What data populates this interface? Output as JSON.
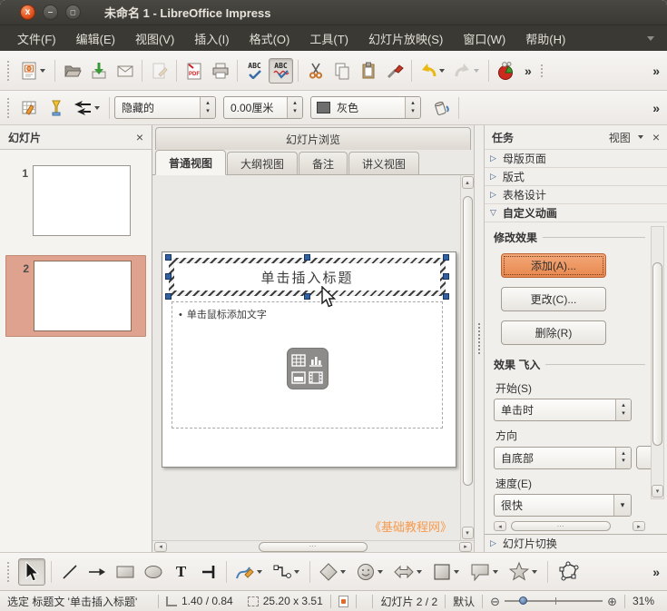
{
  "glyphs": {
    "overflow": "»",
    "close": "×",
    "collapsed": "▷",
    "expanded": "▽",
    "spin_up": "▴",
    "spin_down": "▾",
    "dropdown": "▾",
    "left": "◂",
    "right": "▸",
    "up": "▴",
    "down": "▾",
    "hgrip": "⋯",
    "zoom_out": "⊖",
    "zoom_in": "⊕",
    "bullet": "•",
    "close_x": "x",
    "minimize": "–",
    "maximize": "◻"
  },
  "window": {
    "title": "未命名 1 - LibreOffice Impress"
  },
  "menubar": {
    "items": [
      "文件(F)",
      "编辑(E)",
      "视图(V)",
      "插入(I)",
      "格式(O)",
      "工具(T)",
      "幻灯片放映(S)",
      "窗口(W)",
      "帮助(H)"
    ]
  },
  "toolbar_main": {
    "abc": "ABC",
    "pdf": "PDF"
  },
  "toolbar_line": {
    "line_style": "隐藏的",
    "line_width": "0.00厘米",
    "line_color": "灰色"
  },
  "slides_panel": {
    "title": "幻灯片",
    "slide1_num": "1",
    "slide2_num": "2"
  },
  "view_tabs": {
    "browser": "幻灯片浏览",
    "normal": "普通视图",
    "outline": "大纲视图",
    "notes": "备注",
    "handout": "讲义视图"
  },
  "slide": {
    "title_placeholder": "单击插入标题",
    "body_text": "单击鼠标添加文字",
    "watermark": "《基础教程网》"
  },
  "tasks": {
    "title": "任务",
    "view_menu": "视图",
    "sections": {
      "master": "母版页面",
      "layout": "版式",
      "table_design": "表格设计",
      "custom_animation": "自定义动画",
      "transition": "幻灯片切换"
    },
    "modify_group": "修改效果",
    "add_button": "添加(A)...",
    "change_button": "更改(C)...",
    "remove_button": "删除(R)",
    "effect_group": "效果 飞入",
    "start_label": "开始(S)",
    "start_value": "单击时",
    "direction_label": "方向",
    "direction_value": "自底部",
    "speed_label": "速度(E)",
    "speed_value": "很快"
  },
  "drawbar": {
    "text_tool": "T"
  },
  "statusbar": {
    "selection": "选定 标题文 '单击插入标题'",
    "position": "1.40 / 0.84",
    "size": "25.20 x 3.51",
    "slide_info": "幻灯片 2 / 2",
    "style_name": "默认",
    "zoom_level": "31%"
  },
  "colors": {
    "accent_orange": "#E8884E",
    "selection_salmon": "#DFA28E",
    "watermark_orange": "#F79A4D",
    "handle_blue": "#31629F",
    "titlebar_dark": "#3A3934"
  }
}
